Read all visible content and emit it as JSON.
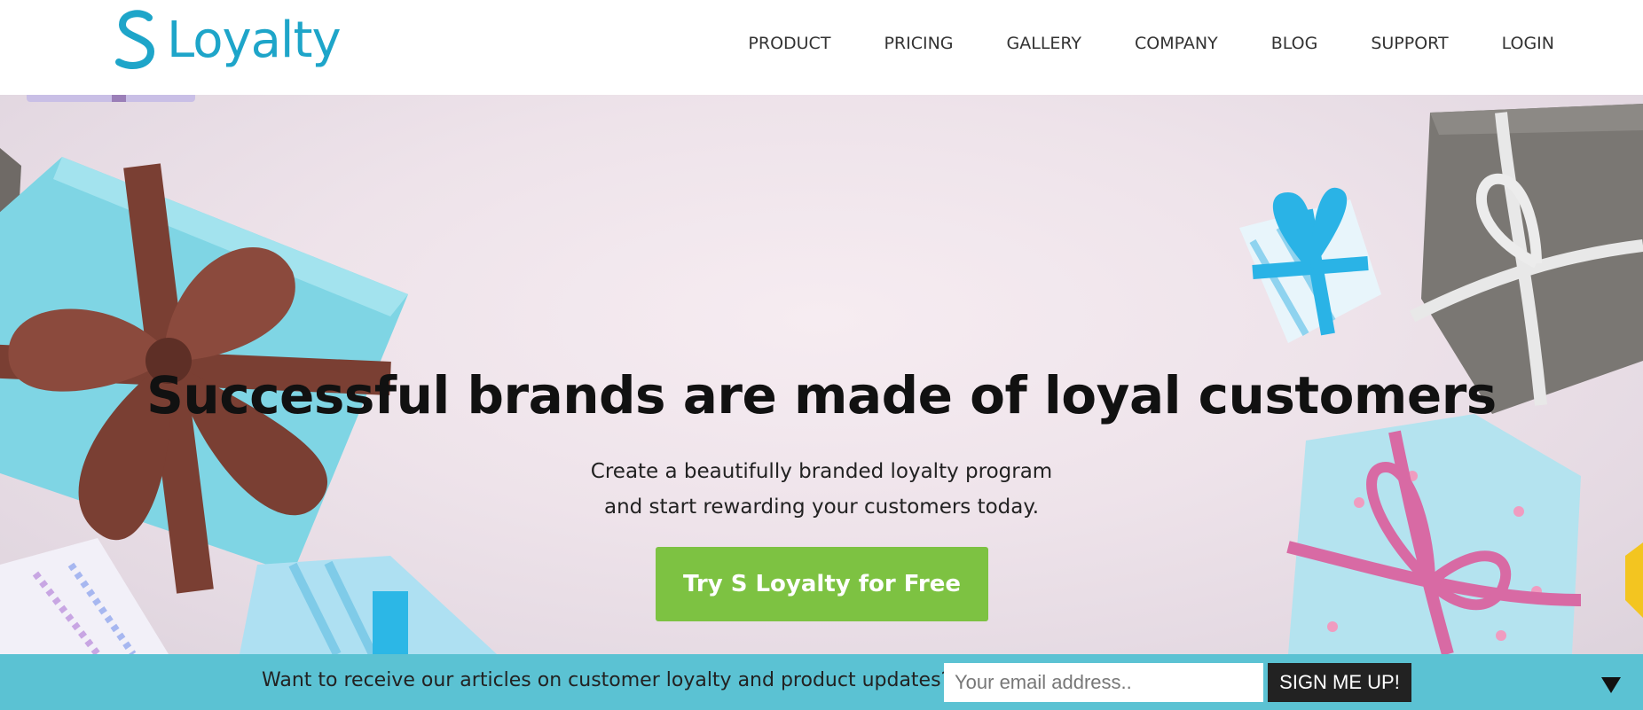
{
  "brand": {
    "name": "Loyalty",
    "color": "#1ea5c9"
  },
  "nav": {
    "items": [
      {
        "label": "PRODUCT"
      },
      {
        "label": "PRICING"
      },
      {
        "label": "GALLERY"
      },
      {
        "label": "COMPANY"
      },
      {
        "label": "BLOG"
      },
      {
        "label": "SUPPORT"
      },
      {
        "label": "LOGIN"
      }
    ]
  },
  "hero": {
    "title": "Successful brands are made of loyal customers",
    "subtitle_line1": "Create a beautifully branded loyalty program",
    "subtitle_line2": "and start rewarding your customers today.",
    "cta_label": "Try S Loyalty for Free",
    "cta_color": "#7dc242"
  },
  "signup": {
    "prompt": "Want to receive our articles on customer loyalty and product updates?",
    "email_placeholder": "Your email address..",
    "button_label": "SIGN ME UP!",
    "bar_color": "#5bc2d3",
    "collapse_icon": "triangle-down-icon"
  }
}
